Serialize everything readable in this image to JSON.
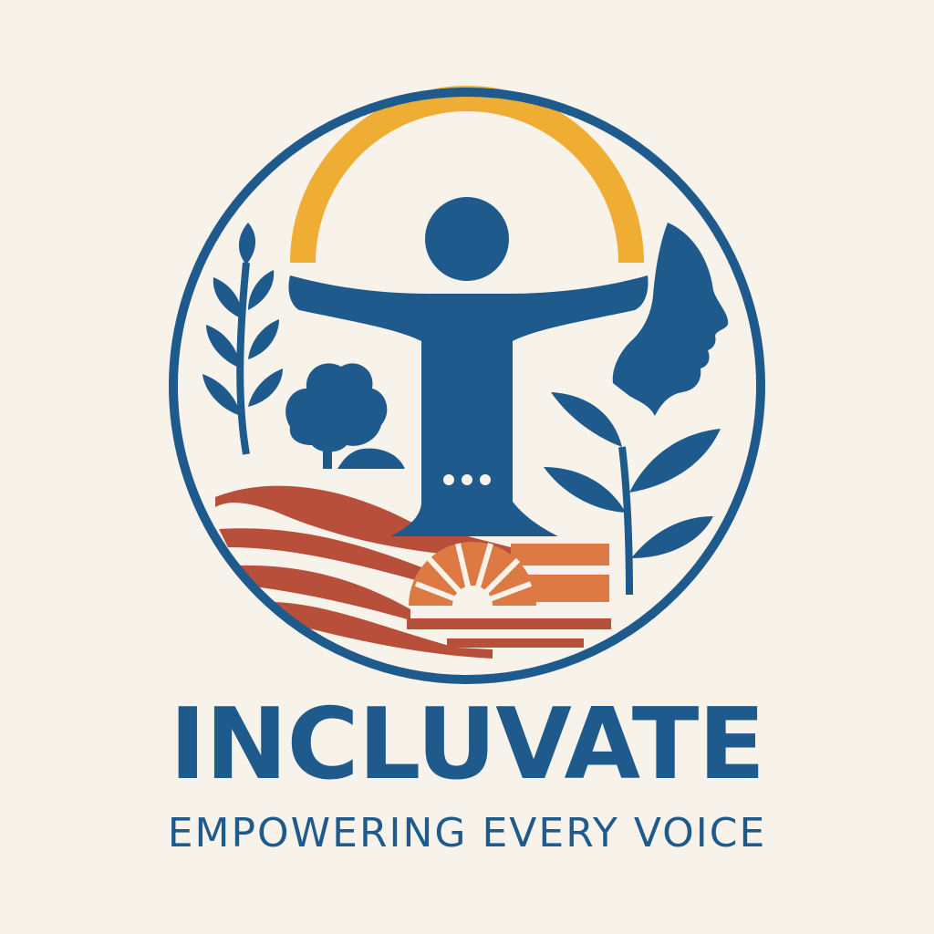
{
  "logo": {
    "brand_name": "INCLUVATE",
    "tagline": "EMPOWERING EVERY VOICE",
    "colors": {
      "background": "#f8f3ea",
      "navy": "#1f5a8c",
      "gold": "#efad33",
      "terracotta": "#b84f3b",
      "orange": "#dd7a44"
    },
    "icons": [
      "ring",
      "sun-arc",
      "person-figure",
      "leaf-sprig",
      "tree",
      "face-profile",
      "plant",
      "field-stripes",
      "setting-sun"
    ]
  }
}
